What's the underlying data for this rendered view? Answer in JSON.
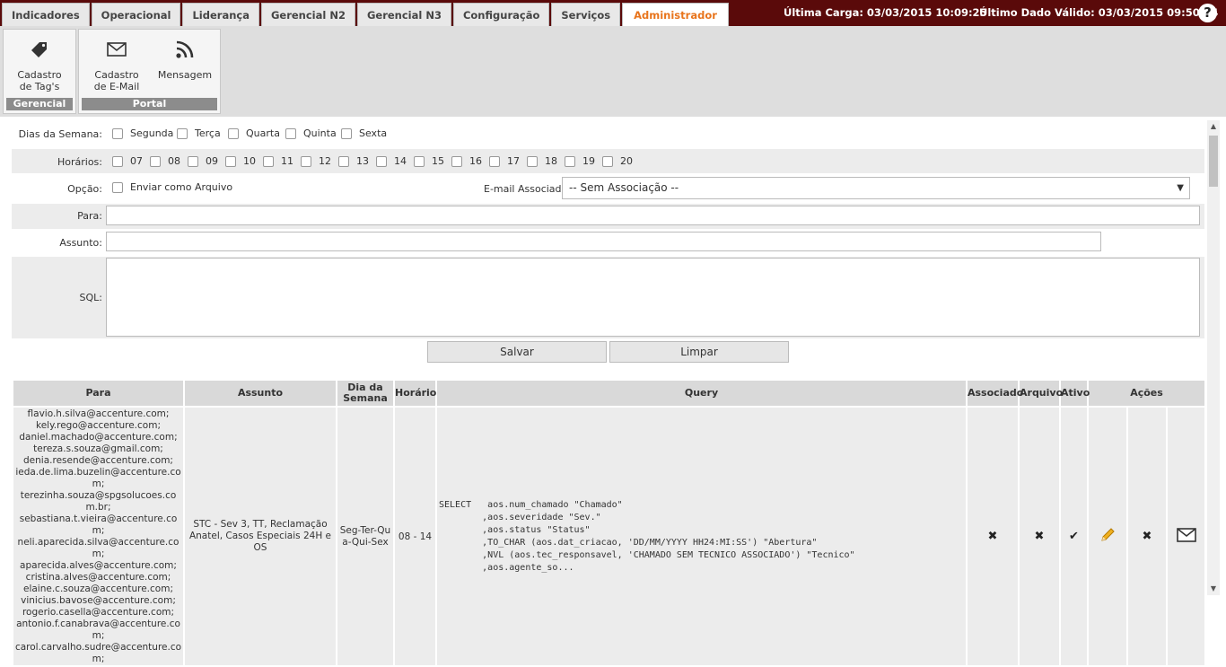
{
  "tabs": [
    "Indicadores",
    "Operacional",
    "Liderança",
    "Gerencial N2",
    "Gerencial N3",
    "Configuração",
    "Serviços",
    "Administrador"
  ],
  "status": {
    "ultima_carga": "Última Carga: 03/03/2015 10:09:25",
    "ultimo_dado": "Último Dado Válido: 03/03/2015 09:50:34",
    "help": "?"
  },
  "ribbon": {
    "gerencial": {
      "label": "Gerencial",
      "cadastro_tags": "Cadastro de Tag's"
    },
    "portal": {
      "label": "Portal",
      "cadastro_email": "Cadastro de E-Mail",
      "mensagem": "Mensagem"
    }
  },
  "form": {
    "dias_label": "Dias da Semana:",
    "dias": [
      "Segunda",
      "Terça",
      "Quarta",
      "Quinta",
      "Sexta"
    ],
    "horarios_label": "Horários:",
    "horarios": [
      "07",
      "08",
      "09",
      "10",
      "11",
      "12",
      "13",
      "14",
      "15",
      "16",
      "17",
      "18",
      "19",
      "20"
    ],
    "opcao_label": "Opção:",
    "enviar_arquivo": "Enviar como Arquivo",
    "email_assoc_label": "E-mail Associado:",
    "email_assoc_value": "-- Sem Associação --",
    "para_label": "Para:",
    "para_value": "",
    "assunto_label": "Assunto:",
    "assunto_value": "",
    "sql_label": "SQL:",
    "sql_value": "",
    "salvar": "Salvar",
    "limpar": "Limpar"
  },
  "table": {
    "headers": {
      "para": "Para",
      "assunto": "Assunto",
      "dia": "Dia da Semana",
      "horario": "Horário",
      "query": "Query",
      "associado": "Associado",
      "arquivo": "Arquivo",
      "ativo": "Ativo",
      "acoes": "Ações"
    },
    "row": {
      "para": [
        "flavio.h.silva@accenture.com;",
        "kely.rego@accenture.com;",
        "daniel.machado@accenture.com;",
        "tereza.s.souza@gmail.com;",
        "denia.resende@accenture.com;",
        "ieda.de.lima.buzelin@accenture.com;",
        "terezinha.souza@spgsolucoes.com.br;",
        "sebastiana.t.vieira@accenture.com;",
        "neli.aparecida.silva@accenture.com;",
        "aparecida.alves@accenture.com;",
        "cristina.alves@accenture.com;",
        "elaine.c.souza@accenture.com;",
        "vinicius.bavose@accenture.com;",
        "rogerio.casella@accenture.com;",
        "antonio.f.canabrava@accenture.com;",
        "carol.carvalho.sudre@accenture.com;"
      ],
      "assunto": "STC - Sev 3, TT, Reclamação Anatel, Casos Especiais 24H e OS",
      "dia": "Seg-Ter-Qua-Qui-Sex",
      "horario": "08 - 14",
      "query": [
        "SELECT   aos.num_chamado \"Chamado\"",
        "        ,aos.severidade \"Sev.\"",
        "        ,aos.status \"Status\"",
        "        ,TO_CHAR (aos.dat_criacao, 'DD/MM/YYYY HH24:MI:SS') \"Abertura\"",
        "        ,NVL (aos.tec_responsavel, 'CHAMADO SEM TECNICO ASSOCIADO') \"Tecnico\"",
        "        ,aos.agente_so..."
      ],
      "associado_icon": "close-icon",
      "arquivo_icon": "close-icon",
      "ativo_icon": "check-icon"
    }
  }
}
